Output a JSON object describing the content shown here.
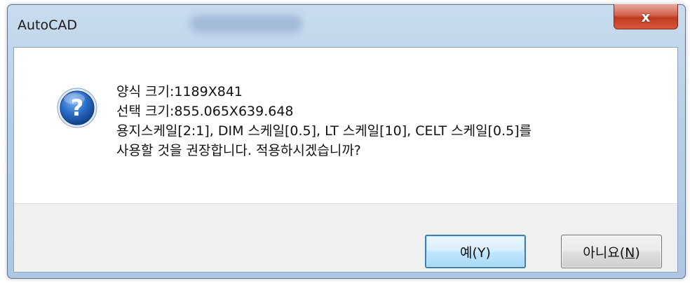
{
  "window": {
    "title": "AutoCAD"
  },
  "title_bar": {
    "close_label": "x"
  },
  "dialog": {
    "icon": "question-icon",
    "message_lines": [
      "양식 크기:1189X841",
      "선택 크기:855.065X639.648",
      "용지스케일[2:1], DIM 스케일[0.5], LT 스케일[10], CELT 스케일[0.5]를",
      "사용할 것을 권장합니다. 적용하시겠습니까?"
    ]
  },
  "buttons": {
    "yes_label": "예(Y)",
    "no_label_prefix": "아니요(",
    "no_label_mnemonic": "N",
    "no_label_suffix": ")"
  },
  "colors": {
    "accent": "#3c7fb1",
    "icon_blue": "#1e5fb8",
    "close_red": "#c0391f"
  }
}
